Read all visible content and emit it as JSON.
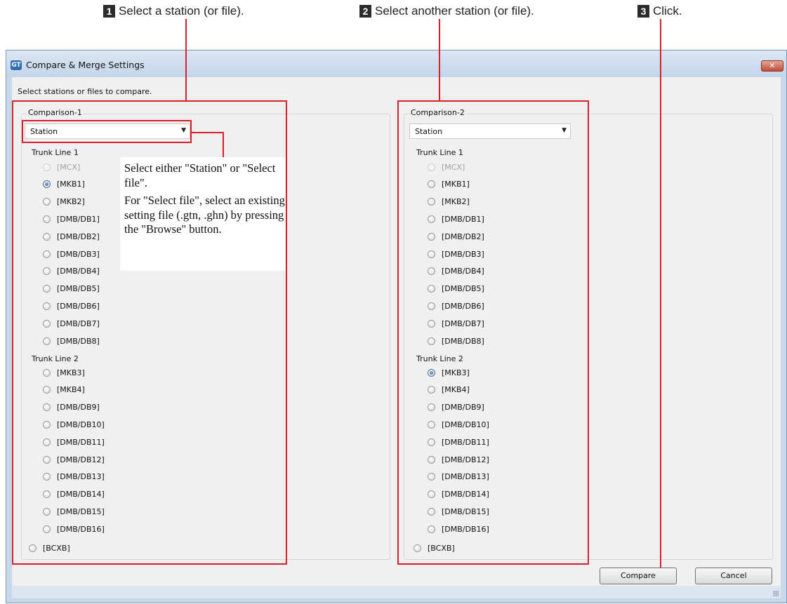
{
  "steps": [
    {
      "num": "1",
      "text": "Select a station (or file)."
    },
    {
      "num": "2",
      "text": "Select another station (or file)."
    },
    {
      "num": "3",
      "text": "Click."
    }
  ],
  "window": {
    "title": "Compare & Merge Settings",
    "app_icon": "gt-app-icon",
    "close_label": "✕",
    "instruction": "Select stations or files to compare."
  },
  "comparisons": [
    {
      "legend": "Comparison-1",
      "source": "Station",
      "trunk1_label": "Trunk Line 1",
      "trunk1": [
        {
          "label": "[MCX]",
          "state": "disabled"
        },
        {
          "label": "[MKB1]",
          "state": "checked"
        },
        {
          "label": "[MKB2]",
          "state": "unchecked"
        },
        {
          "label": "[DMB/DB1]",
          "state": "unchecked"
        },
        {
          "label": "[DMB/DB2]",
          "state": "unchecked"
        },
        {
          "label": "[DMB/DB3]",
          "state": "unchecked"
        },
        {
          "label": "[DMB/DB4]",
          "state": "unchecked"
        },
        {
          "label": "[DMB/DB5]",
          "state": "unchecked"
        },
        {
          "label": "[DMB/DB6]",
          "state": "unchecked"
        },
        {
          "label": "[DMB/DB7]",
          "state": "unchecked"
        },
        {
          "label": "[DMB/DB8]",
          "state": "unchecked"
        }
      ],
      "trunk2_label": "Trunk Line 2",
      "trunk2": [
        {
          "label": "[MKB3]",
          "state": "unchecked"
        },
        {
          "label": "[MKB4]",
          "state": "unchecked"
        },
        {
          "label": "[DMB/DB9]",
          "state": "unchecked"
        },
        {
          "label": "[DMB/DB10]",
          "state": "unchecked"
        },
        {
          "label": "[DMB/DB11]",
          "state": "unchecked"
        },
        {
          "label": "[DMB/DB12]",
          "state": "unchecked"
        },
        {
          "label": "[DMB/DB13]",
          "state": "unchecked"
        },
        {
          "label": "[DMB/DB14]",
          "state": "unchecked"
        },
        {
          "label": "[DMB/DB15]",
          "state": "unchecked"
        },
        {
          "label": "[DMB/DB16]",
          "state": "unchecked"
        }
      ],
      "bcxb": {
        "label": "[BCXB]",
        "state": "unchecked"
      }
    },
    {
      "legend": "Comparison-2",
      "source": "Station",
      "trunk1_label": "Trunk Line 1",
      "trunk1": [
        {
          "label": "[MCX]",
          "state": "disabled"
        },
        {
          "label": "[MKB1]",
          "state": "unchecked"
        },
        {
          "label": "[MKB2]",
          "state": "unchecked"
        },
        {
          "label": "[DMB/DB1]",
          "state": "unchecked"
        },
        {
          "label": "[DMB/DB2]",
          "state": "unchecked"
        },
        {
          "label": "[DMB/DB3]",
          "state": "unchecked"
        },
        {
          "label": "[DMB/DB4]",
          "state": "unchecked"
        },
        {
          "label": "[DMB/DB5]",
          "state": "unchecked"
        },
        {
          "label": "[DMB/DB6]",
          "state": "unchecked"
        },
        {
          "label": "[DMB/DB7]",
          "state": "unchecked"
        },
        {
          "label": "[DMB/DB8]",
          "state": "unchecked"
        }
      ],
      "trunk2_label": "Trunk Line 2",
      "trunk2": [
        {
          "label": "[MKB3]",
          "state": "checked"
        },
        {
          "label": "[MKB4]",
          "state": "unchecked"
        },
        {
          "label": "[DMB/DB9]",
          "state": "unchecked"
        },
        {
          "label": "[DMB/DB10]",
          "state": "unchecked"
        },
        {
          "label": "[DMB/DB11]",
          "state": "unchecked"
        },
        {
          "label": "[DMB/DB12]",
          "state": "unchecked"
        },
        {
          "label": "[DMB/DB13]",
          "state": "unchecked"
        },
        {
          "label": "[DMB/DB14]",
          "state": "unchecked"
        },
        {
          "label": "[DMB/DB15]",
          "state": "unchecked"
        },
        {
          "label": "[DMB/DB16]",
          "state": "unchecked"
        }
      ],
      "bcxb": {
        "label": "[BCXB]",
        "state": "unchecked"
      }
    }
  ],
  "note": {
    "line1": "Select either \"Station\" or \"Select file\".",
    "line2": "For \"Select file\", select an existing setting file (.gtn, .ghn) by pressing the \"Browse\" button."
  },
  "buttons": {
    "compare": "Compare",
    "cancel": "Cancel"
  },
  "colors": {
    "annotation_red": "#d8212b",
    "radio_checked": "#1d4f93",
    "title_bar": "#c7d8ea"
  }
}
